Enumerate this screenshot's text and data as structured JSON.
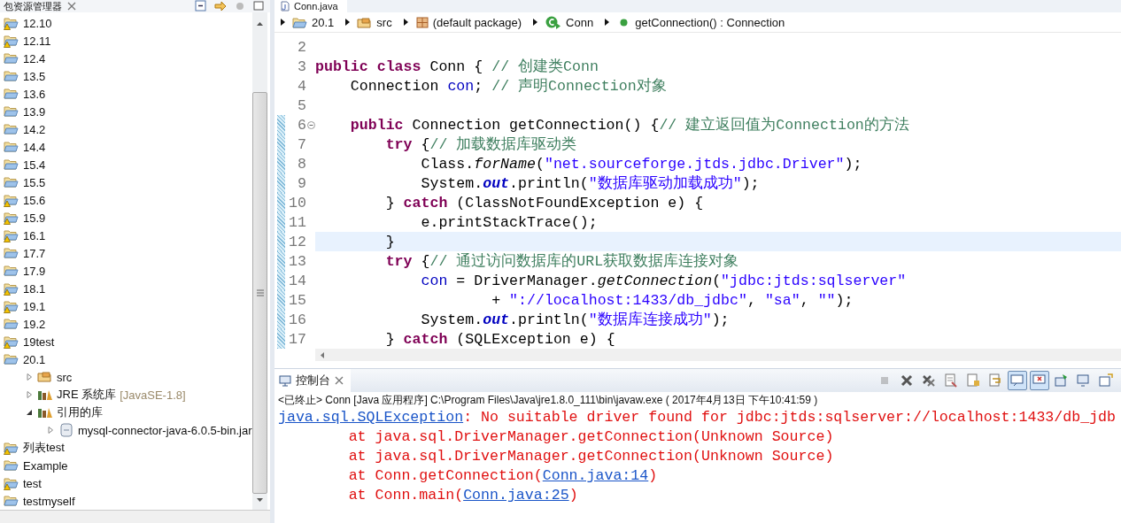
{
  "sidebar": {
    "title": "包资源管理器",
    "items": [
      {
        "label": "12.10",
        "kind": "project",
        "warning": true
      },
      {
        "label": "12.11",
        "kind": "project",
        "warning": true
      },
      {
        "label": "12.4",
        "kind": "project",
        "warning": false
      },
      {
        "label": "13.5",
        "kind": "project",
        "warning": false
      },
      {
        "label": "13.6",
        "kind": "project",
        "warning": false
      },
      {
        "label": "13.9",
        "kind": "project",
        "warning": false
      },
      {
        "label": "14.2",
        "kind": "project",
        "warning": false
      },
      {
        "label": "14.4",
        "kind": "project",
        "warning": false
      },
      {
        "label": "15.4",
        "kind": "project",
        "warning": false
      },
      {
        "label": "15.5",
        "kind": "project",
        "warning": false
      },
      {
        "label": "15.6",
        "kind": "project",
        "warning": true
      },
      {
        "label": "15.9",
        "kind": "project",
        "warning": true
      },
      {
        "label": "16.1",
        "kind": "project",
        "warning": true
      },
      {
        "label": "17.7",
        "kind": "project",
        "warning": false
      },
      {
        "label": "17.9",
        "kind": "project",
        "warning": false
      },
      {
        "label": "18.1",
        "kind": "project",
        "warning": true
      },
      {
        "label": "19.1",
        "kind": "project",
        "warning": true
      },
      {
        "label": "19.2",
        "kind": "project",
        "warning": false
      },
      {
        "label": "19test",
        "kind": "project",
        "warning": true
      },
      {
        "label": "20.1",
        "kind": "project",
        "warning": false,
        "children": [
          {
            "label": "src",
            "kind": "source-folder",
            "expanded": false
          },
          {
            "label": "JRE 系统库",
            "decoration": "[JavaSE-1.8]",
            "kind": "library",
            "expanded": false
          },
          {
            "label": "引用的库",
            "kind": "library",
            "expanded": true,
            "children": [
              {
                "label": "mysql-connector-java-6.0.5-bin.jar",
                "kind": "jar",
                "expanded": false
              }
            ]
          }
        ]
      },
      {
        "label": "列表test",
        "kind": "project",
        "warning": true
      },
      {
        "label": "Example",
        "kind": "project",
        "warning": false
      },
      {
        "label": "test",
        "kind": "project",
        "warning": true
      },
      {
        "label": "testmyself",
        "kind": "project",
        "warning": false
      }
    ]
  },
  "editor": {
    "tab": "Conn.java",
    "breadcrumbs": [
      {
        "label": "20.1",
        "kind": "project"
      },
      {
        "label": "src",
        "kind": "source-folder"
      },
      {
        "label": "(default package)",
        "kind": "package"
      },
      {
        "label": "Conn",
        "kind": "class"
      },
      {
        "label": "getConnection() : Connection",
        "kind": "method"
      }
    ],
    "lines": [
      {
        "no": "2",
        "changed": false,
        "current": false,
        "foldable": false
      },
      {
        "no": "3",
        "changed": false,
        "current": false,
        "foldable": false,
        "tokens": [
          {
            "kind": "kw",
            "text": "public class"
          },
          {
            "kind": "plain",
            "text": " Conn { "
          },
          {
            "kind": "comment",
            "text": "// 创建类Conn"
          }
        ]
      },
      {
        "no": "4",
        "changed": false,
        "current": false,
        "foldable": false,
        "tokens": [
          {
            "kind": "plain",
            "text": "    Connection "
          },
          {
            "kind": "field",
            "text": "con"
          },
          {
            "kind": "plain",
            "text": "; "
          },
          {
            "kind": "comment",
            "text": "// 声明Connection对象"
          }
        ]
      },
      {
        "no": "5",
        "changed": false,
        "current": false,
        "foldable": false
      },
      {
        "no": "6",
        "changed": true,
        "current": false,
        "foldable": true,
        "tokens": [
          {
            "kind": "kw",
            "text": "    public"
          },
          {
            "kind": "plain",
            "text": " Connection getConnection() {"
          },
          {
            "kind": "comment",
            "text": "// 建立返回值为Connection的方法"
          }
        ]
      },
      {
        "no": "7",
        "changed": true,
        "current": false,
        "foldable": false,
        "tokens": [
          {
            "kind": "kw",
            "text": "        try"
          },
          {
            "kind": "plain",
            "text": " {"
          },
          {
            "kind": "comment",
            "text": "// 加载数据库驱动类"
          }
        ]
      },
      {
        "no": "8",
        "changed": true,
        "current": false,
        "foldable": false,
        "tokens": [
          {
            "kind": "plain",
            "text": "            Class."
          },
          {
            "kind": "italic",
            "text": "forName"
          },
          {
            "kind": "plain",
            "text": "("
          },
          {
            "kind": "string",
            "text": "\"net.sourceforge.jtds.jdbc.Driver\""
          },
          {
            "kind": "plain",
            "text": ");"
          }
        ]
      },
      {
        "no": "9",
        "changed": true,
        "current": false,
        "foldable": false,
        "tokens": [
          {
            "kind": "plain",
            "text": "            System."
          },
          {
            "kind": "static",
            "text": "out"
          },
          {
            "kind": "plain",
            "text": ".println("
          },
          {
            "kind": "string",
            "text": "\"数据库驱动加载成功\""
          },
          {
            "kind": "plain",
            "text": ");"
          }
        ]
      },
      {
        "no": "10",
        "changed": true,
        "current": false,
        "foldable": false,
        "tokens": [
          {
            "kind": "plain",
            "text": "        } "
          },
          {
            "kind": "kw",
            "text": "catch"
          },
          {
            "kind": "plain",
            "text": " (ClassNotFoundException e) {"
          }
        ]
      },
      {
        "no": "11",
        "changed": true,
        "current": false,
        "foldable": false,
        "tokens": [
          {
            "kind": "plain",
            "text": "            e.printStackTrace();"
          }
        ]
      },
      {
        "no": "12",
        "changed": true,
        "current": true,
        "foldable": false,
        "tokens": [
          {
            "kind": "plain",
            "text": "        }"
          }
        ]
      },
      {
        "no": "13",
        "changed": true,
        "current": false,
        "foldable": false,
        "tokens": [
          {
            "kind": "kw",
            "text": "        try"
          },
          {
            "kind": "plain",
            "text": " {"
          },
          {
            "kind": "comment",
            "text": "// 通过访问数据库的URL获取数据库连接对象"
          }
        ]
      },
      {
        "no": "14",
        "changed": true,
        "current": false,
        "foldable": false,
        "tokens": [
          {
            "kind": "field",
            "text": "            con"
          },
          {
            "kind": "plain",
            "text": " = DriverManager."
          },
          {
            "kind": "italic",
            "text": "getConnection"
          },
          {
            "kind": "plain",
            "text": "("
          },
          {
            "kind": "string",
            "text": "\"jdbc:jtds:sqlserver\""
          }
        ]
      },
      {
        "no": "15",
        "changed": true,
        "current": false,
        "foldable": false,
        "tokens": [
          {
            "kind": "plain",
            "text": "                    + "
          },
          {
            "kind": "string",
            "text": "\"://localhost:1433/db_jdbc\""
          },
          {
            "kind": "plain",
            "text": ", "
          },
          {
            "kind": "string",
            "text": "\"sa\""
          },
          {
            "kind": "plain",
            "text": ", "
          },
          {
            "kind": "string",
            "text": "\"\""
          },
          {
            "kind": "plain",
            "text": ");"
          }
        ]
      },
      {
        "no": "16",
        "changed": true,
        "current": false,
        "foldable": false,
        "tokens": [
          {
            "kind": "plain",
            "text": "            System."
          },
          {
            "kind": "static",
            "text": "out"
          },
          {
            "kind": "plain",
            "text": ".println("
          },
          {
            "kind": "string",
            "text": "\"数据库连接成功\""
          },
          {
            "kind": "plain",
            "text": ");"
          }
        ]
      },
      {
        "no": "17",
        "changed": true,
        "current": false,
        "foldable": false,
        "tokens": [
          {
            "kind": "plain",
            "text": "        } "
          },
          {
            "kind": "kw",
            "text": "catch"
          },
          {
            "kind": "plain",
            "text": " (SQLException e) {"
          }
        ]
      }
    ]
  },
  "console": {
    "tab": "控制台",
    "toolbar": [
      {
        "kind": "terminate",
        "disabled": true,
        "pressed": false
      },
      {
        "kind": "remove",
        "disabled": false,
        "pressed": false
      },
      {
        "kind": "remove-all",
        "disabled": false,
        "pressed": false
      },
      {
        "kind": "clear",
        "disabled": false,
        "pressed": false
      },
      {
        "kind": "scroll-lock",
        "disabled": false,
        "pressed": false
      },
      {
        "kind": "word-wrap",
        "disabled": false,
        "pressed": false
      },
      {
        "kind": "show-out",
        "disabled": false,
        "pressed": true
      },
      {
        "kind": "show-err",
        "disabled": false,
        "pressed": true
      },
      {
        "kind": "pin",
        "disabled": false,
        "pressed": false
      },
      {
        "kind": "display",
        "disabled": false,
        "pressed": false
      },
      {
        "kind": "open",
        "disabled": false,
        "pressed": false
      }
    ],
    "header": "<已终止> Conn [Java 应用程序] C:\\Program Files\\Java\\jre1.8.0_111\\bin\\javaw.exe ( 2017年4月13日 下午10:41:59 )",
    "lines": [
      [
        {
          "kind": "link",
          "text": "java.sql.SQLException"
        },
        {
          "kind": "error",
          "text": ": No suitable driver found for jdbc:jtds:sqlserver://localhost:1433/db_jdb"
        }
      ],
      [
        {
          "kind": "error",
          "text": "        at java.sql.DriverManager.getConnection(Unknown Source)"
        }
      ],
      [
        {
          "kind": "error",
          "text": "        at java.sql.DriverManager.getConnection(Unknown Source)"
        }
      ],
      [
        {
          "kind": "error",
          "text": "        at Conn.getConnection("
        },
        {
          "kind": "link",
          "text": "Conn.java:14"
        },
        {
          "kind": "error",
          "text": ")"
        }
      ],
      [
        {
          "kind": "error",
          "text": "        at Conn.main("
        },
        {
          "kind": "link",
          "text": "Conn.java:25"
        },
        {
          "kind": "error",
          "text": ")"
        }
      ]
    ]
  }
}
